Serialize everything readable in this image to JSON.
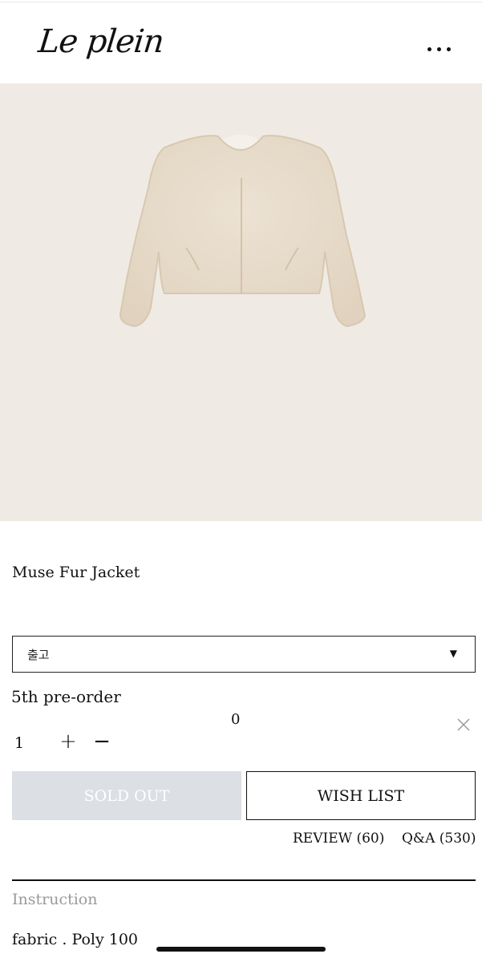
{
  "brand": {
    "logo_text": "Le plein"
  },
  "header": {
    "menu_icon": "more-horizontal-icon"
  },
  "product": {
    "name": "Muse Fur Jacket",
    "image_description_icon": "fur-jacket-image",
    "option_select": {
      "selected": "출고"
    },
    "selected_item": {
      "label": "5th pre-order",
      "price": "0",
      "quantity": "1"
    }
  },
  "actions": {
    "sold_out_label": "SOLD OUT",
    "wishlist_label": "WISH LIST",
    "review_label": "REVIEW (60)",
    "qa_label": "Q&A (530)"
  },
  "details": {
    "instruction_label": "Instruction",
    "fabric_text": "fabric . Poly 100"
  },
  "colors": {
    "hero_bg": "#efebe4",
    "jacket": "#e8dccb",
    "sold_out_bg": "#dcdfe3"
  }
}
